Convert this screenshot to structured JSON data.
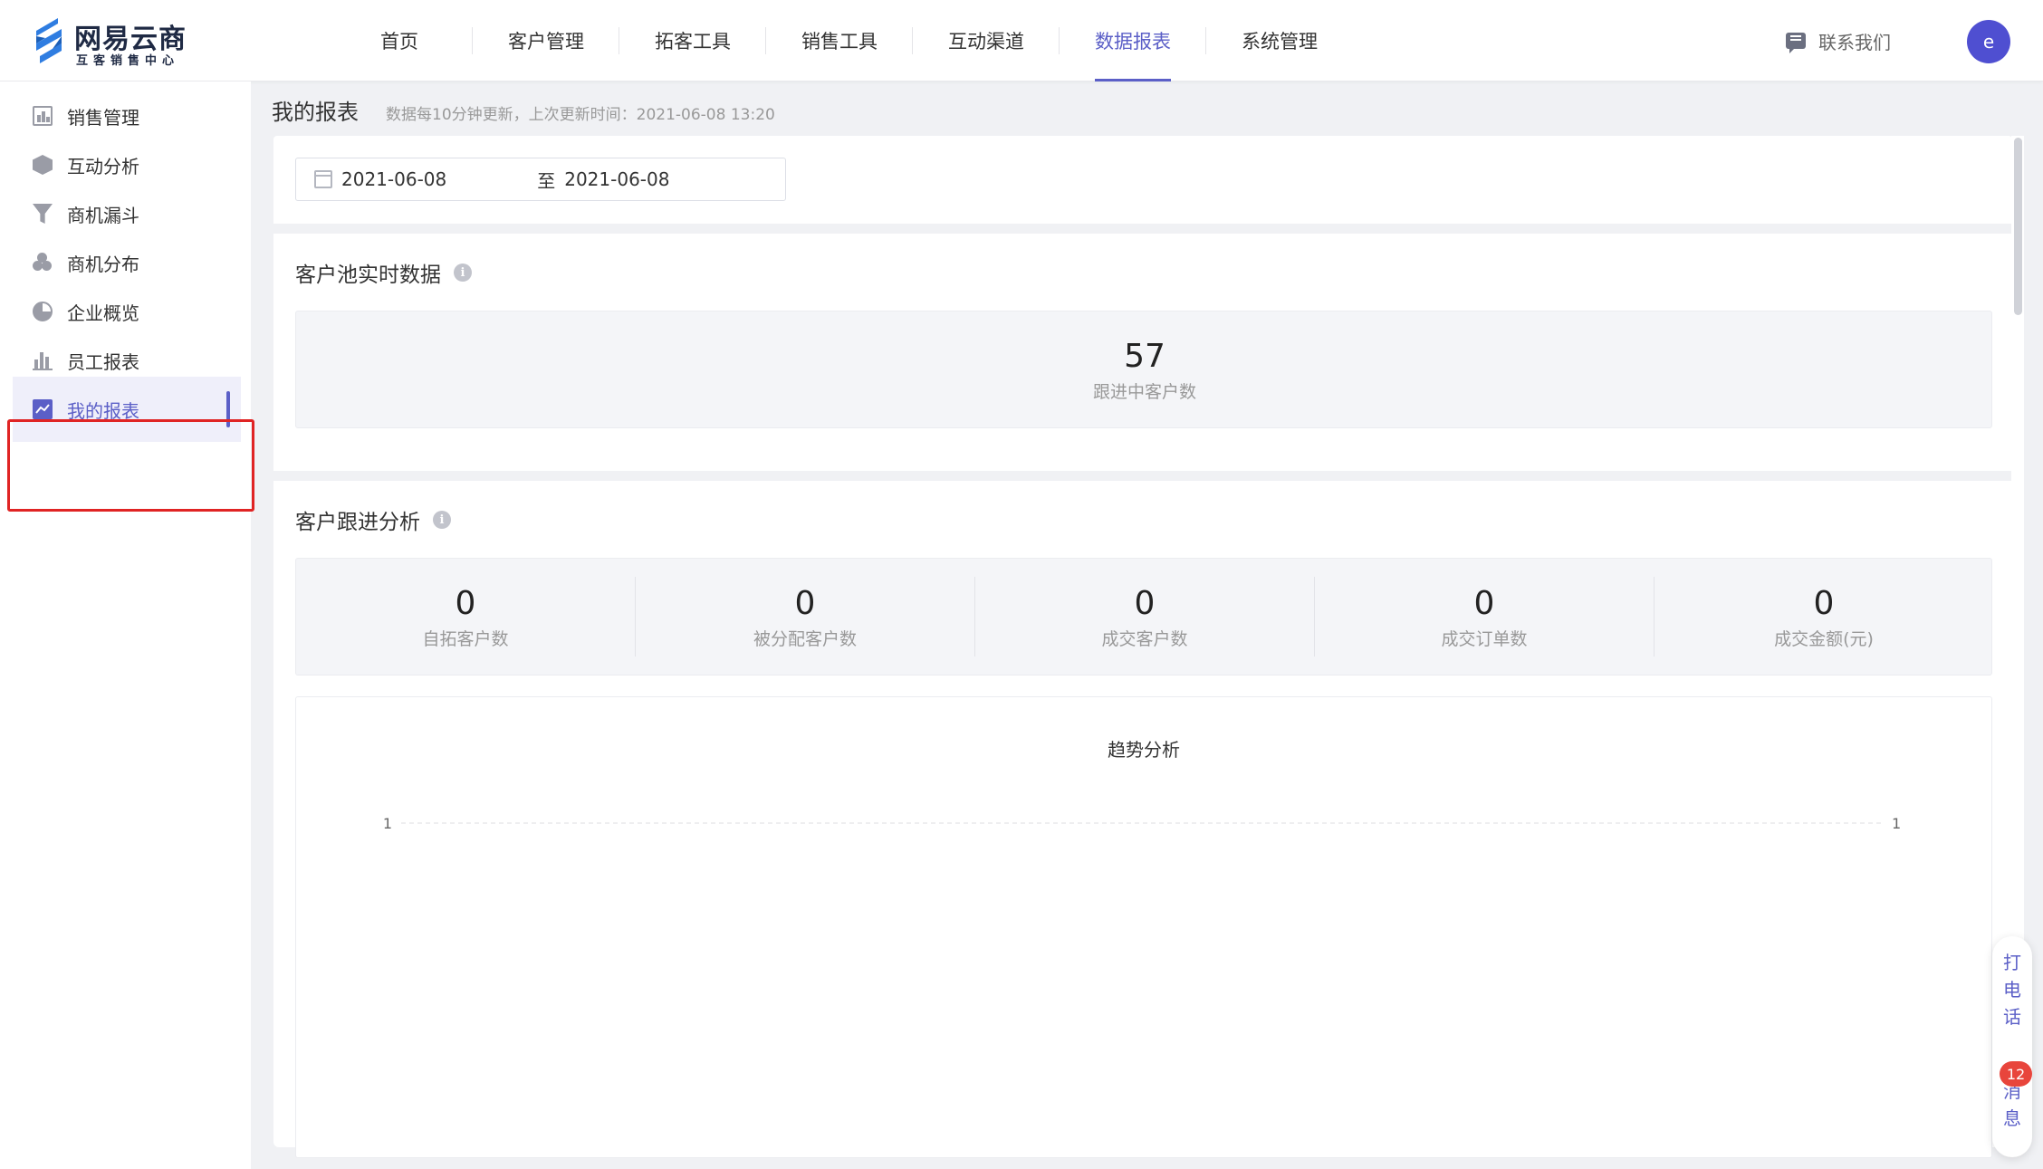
{
  "brand": {
    "title": "网易云商",
    "subtitle": "互客销售中心"
  },
  "nav": {
    "items": [
      {
        "label": "首页"
      },
      {
        "label": "客户管理"
      },
      {
        "label": "拓客工具"
      },
      {
        "label": "销售工具"
      },
      {
        "label": "互动渠道"
      },
      {
        "label": "数据报表",
        "active": true
      },
      {
        "label": "系统管理"
      }
    ],
    "contact": "联系我们",
    "avatar": "e"
  },
  "sidebar": {
    "items": [
      {
        "label": "销售管理",
        "icon": "bar-chart-icon"
      },
      {
        "label": "互动分析",
        "icon": "cube-icon"
      },
      {
        "label": "商机漏斗",
        "icon": "funnel-icon"
      },
      {
        "label": "商机分布",
        "icon": "cluster-icon"
      },
      {
        "label": "企业概览",
        "icon": "pie-chart-icon"
      },
      {
        "label": "员工报表",
        "icon": "column-chart-icon"
      },
      {
        "label": "我的报表",
        "icon": "trend-icon",
        "active": true
      }
    ]
  },
  "page": {
    "title": "我的报表",
    "note": "数据每10分钟更新，上次更新时间：2021-06-08 13:20"
  },
  "date_range": {
    "start": "2021-06-08",
    "separator": "至",
    "end": "2021-06-08"
  },
  "pool": {
    "title": "客户池实时数据",
    "info": "i",
    "stat": {
      "value": "57",
      "label": "跟进中客户数"
    }
  },
  "follow": {
    "title": "客户跟进分析",
    "info": "i",
    "stats": [
      {
        "value": "0",
        "label": "自拓客户数"
      },
      {
        "value": "0",
        "label": "被分配客户数"
      },
      {
        "value": "0",
        "label": "成交客户数"
      },
      {
        "value": "0",
        "label": "成交订单数"
      },
      {
        "value": "0",
        "label": "成交金额(元)"
      }
    ]
  },
  "float_widget": {
    "call": [
      "打",
      "电",
      "话"
    ],
    "message": [
      "消",
      "息"
    ],
    "badge": "12"
  },
  "colors": {
    "accent": "#5b5fc7",
    "highlight": "#e02424",
    "badge": "#e8453c"
  },
  "chart_data": {
    "type": "line",
    "title": "趋势分析",
    "y_ticks_left": [
      "1"
    ],
    "y_ticks_right": [
      "1"
    ],
    "series": [],
    "grid": true
  }
}
